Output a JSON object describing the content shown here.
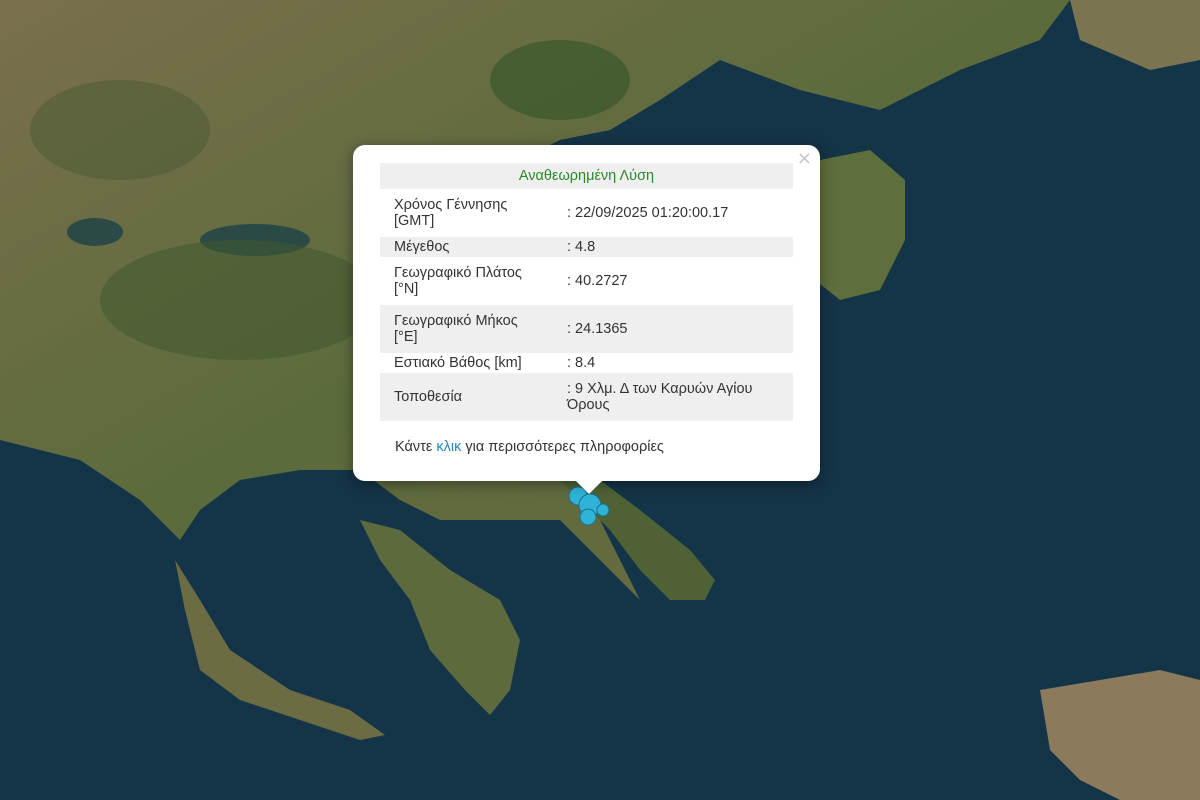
{
  "popup": {
    "title": "Αναθεωρημένη Λύση",
    "close_label": "×",
    "rows": [
      {
        "label": "Χρόνος Γέννησης [GMT]",
        "value": ": 22/09/2025 01:20:00.17"
      },
      {
        "label": "Μέγεθος",
        "value": ": 4.8"
      },
      {
        "label": "Γεωγραφικό Πλάτος [°N]",
        "value": ": 40.2727"
      },
      {
        "label": "Γεωγραφικό Μήκος [°E]",
        "value": ": 24.1365"
      },
      {
        "label": "Εστιακό Βάθος [km]",
        "value": ": 8.4"
      },
      {
        "label": "Τοποθεσία",
        "value": ": 9 Χλμ. Δ των Καρυών Αγίου Όρους"
      }
    ],
    "more_prefix": "Κάντε ",
    "more_link": "κλικ",
    "more_suffix": " για περισσότερες πληροφορίες"
  },
  "map": {
    "sea_color": "#143447",
    "land_color": "#5d6a3e",
    "marker_color": "#2fb4d8",
    "marker_icon": "earthquake-marker"
  }
}
